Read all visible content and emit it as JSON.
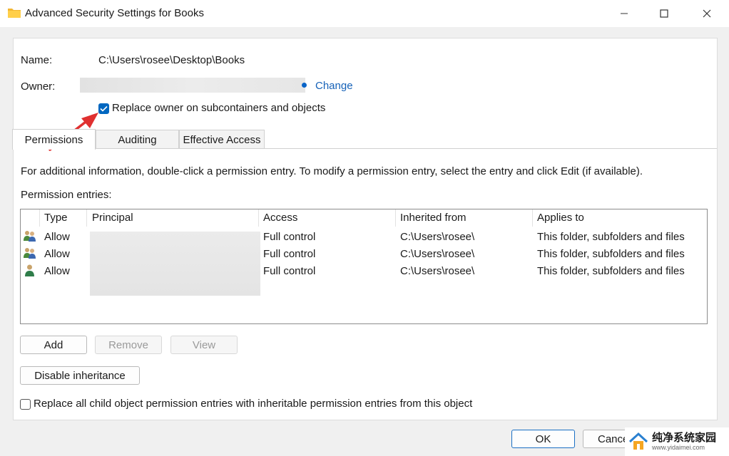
{
  "window": {
    "title": "Advanced Security Settings for Books",
    "minimize_icon": "minimize-icon",
    "maximize_icon": "maximize-icon",
    "close_icon": "close-icon"
  },
  "name_row": {
    "label": "Name:",
    "value": "C:\\Users\\rosee\\Desktop\\Books"
  },
  "owner_row": {
    "label": "Owner:",
    "change_link": "Change"
  },
  "replace_owner": {
    "label": "Replace owner on subcontainers and objects",
    "checked": true
  },
  "tabs": [
    {
      "label": "Permissions",
      "active": true
    },
    {
      "label": "Auditing",
      "active": false
    },
    {
      "label": "Effective Access",
      "active": false
    }
  ],
  "info_text": "For additional information, double-click a permission entry. To modify a permission entry, select the entry and click Edit (if available).",
  "entries_label": "Permission entries:",
  "table": {
    "columns": [
      "Type",
      "Principal",
      "Access",
      "Inherited from",
      "Applies to"
    ],
    "rows": [
      {
        "icon": "user-group-icon",
        "type": "Allow",
        "principal": "",
        "access": "Full control",
        "inherited": "C:\\Users\\rosee\\",
        "applies": "This folder, subfolders and files"
      },
      {
        "icon": "user-group-icon",
        "type": "Allow",
        "principal": "",
        "access": "Full control",
        "inherited": "C:\\Users\\rosee\\",
        "applies": "This folder, subfolders and files"
      },
      {
        "icon": "user-icon",
        "type": "Allow",
        "principal": "",
        "access": "Full control",
        "inherited": "C:\\Users\\rosee\\",
        "applies": "This folder, subfolders and files"
      }
    ]
  },
  "buttons": {
    "add": "Add",
    "remove": "Remove",
    "view": "View",
    "disable_inheritance": "Disable inheritance",
    "ok": "OK",
    "cancel": "Cance"
  },
  "replace_child": {
    "label": "Replace all child object permission entries with inheritable permission entries from this object",
    "checked": false
  },
  "watermark": {
    "title": "纯净系统家园",
    "url": "www.yidaimei.com"
  },
  "colors": {
    "accent": "#0067c0",
    "link": "#1662b8",
    "arrow": "#e03030"
  }
}
